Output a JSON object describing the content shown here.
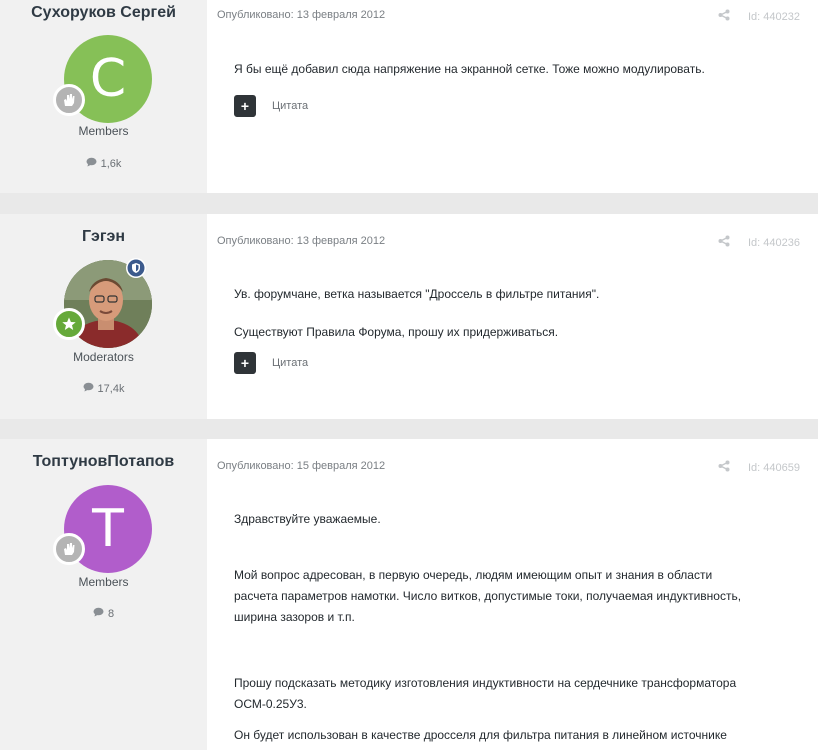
{
  "posts": [
    {
      "author": "Сухоруков Сергей",
      "avatar_letter": "С",
      "avatar_color": "#86c057",
      "group": "Members",
      "count": "1,6k",
      "published": "Опубликовано: 13 февраля 2012",
      "id": "Id: 440232",
      "paragraphs": [
        "Я бы ещё добавил сюда напряжение на экранной сетке. Тоже можно модулировать."
      ],
      "quote_label": "Цитата"
    },
    {
      "author": "Гэгэн",
      "group": "Moderators",
      "count": "17,4k",
      "published": "Опубликовано: 13 февраля 2012",
      "id": "Id: 440236",
      "paragraphs": [
        "Ув. форумчане, ветка называется \"Дроссель в фильтре питания\".",
        "Существуют Правила Форума, прошу их придерживаться."
      ],
      "quote_label": "Цитата"
    },
    {
      "author": "ТоптуновПотапов",
      "avatar_letter": "Т",
      "avatar_color": "#b15dcb",
      "group": "Members",
      "count": "8",
      "published": "Опубликовано: 15 февраля 2012",
      "id": "Id: 440659",
      "paragraphs": [
        "Здравствуйте уважаемые.",
        "Мой вопрос адресован, в первую очередь, людям имеющим опыт и знания в области",
        "расчета параметров намотки. Число витков, допустимые токи, получаемая индуктивность,",
        "ширина зазоров и т.п.",
        "Прошу подсказать методику изготовления индуктивности на сердечнике трансформатора",
        "ОСМ-0.25У3.",
        "Он будет использован в качестве дросселя для фильтра питания в линейном источнике"
      ]
    }
  ]
}
